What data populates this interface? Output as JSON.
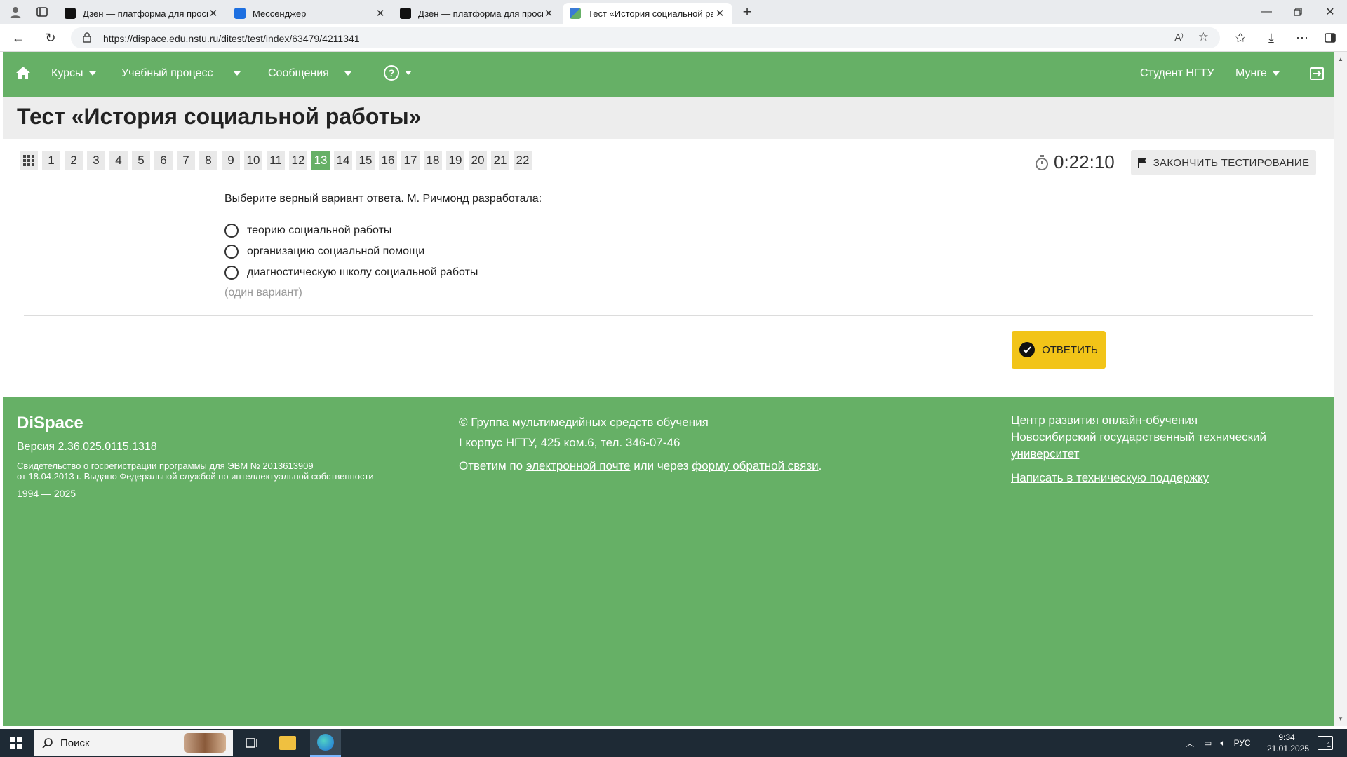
{
  "browser": {
    "tabs": [
      {
        "title": "Дзен — платформа для просмотра",
        "favicon": "dzen"
      },
      {
        "title": "Мессенджер",
        "favicon": "messenger"
      },
      {
        "title": "Дзен — платформа для просмотра",
        "favicon": "dzen"
      },
      {
        "title": "Тест «История социальной работы»",
        "favicon": "dispace",
        "active": true
      }
    ],
    "url": "https://dispace.edu.nstu.ru/ditest/test/index/63479/4211341"
  },
  "nav": {
    "courses": "Курсы",
    "process": "Учебный процесс",
    "messages": "Сообщения",
    "help": "?",
    "student": "Студент НГТУ",
    "user": "Мунге"
  },
  "test": {
    "title": "Тест «История социальной работы»",
    "questions": [
      "1",
      "2",
      "3",
      "4",
      "5",
      "6",
      "7",
      "8",
      "9",
      "10",
      "11",
      "12",
      "13",
      "14",
      "15",
      "16",
      "17",
      "18",
      "19",
      "20",
      "21",
      "22"
    ],
    "current": "13",
    "timer": "0:22:10",
    "finish_label": "ЗАКОНЧИТЬ ТЕСТИРОВАНИЕ",
    "question_text": "Выберите верный вариант ответа. М. Ричмонд разработала:",
    "options": [
      "теорию социальной работы",
      "организацию социальной помощи",
      "диагностическую школу социальной работы"
    ],
    "hint": "(один вариант)",
    "answer_label": "ОТВЕТИТЬ"
  },
  "footer": {
    "brand": "DiSpace",
    "version": "Версия 2.36.025.0115.1318",
    "cert_line1": "Свидетельство о госрегистрации программы для ЭВМ № 2013613909",
    "cert_line2": "от 18.04.2013 г. Выдано Федеральной службой по интеллектуальной собственности",
    "years": "1994 — 2025",
    "group": "© Группа мультимедийных средств обучения",
    "address": "I корпус НГТУ, 425 ком.6, тел. 346-07-46",
    "contact_prefix": "Ответим по",
    "contact_email_link": "электронной почте",
    "contact_mid": "или через",
    "contact_form_link": "форму обратной связи",
    "contact_suffix": ".",
    "link_center": "Центр развития онлайн-обучения",
    "link_university": "Новосибирский государственный технический университет",
    "link_support": "Написать в техническую поддержку"
  },
  "taskbar": {
    "search_placeholder": "Поиск",
    "lang": "РУС",
    "time": "9:34",
    "date": "21.01.2025",
    "notifications": "1"
  },
  "colors": {
    "brand_green": "#66b066",
    "answer_yellow": "#f2c418"
  }
}
